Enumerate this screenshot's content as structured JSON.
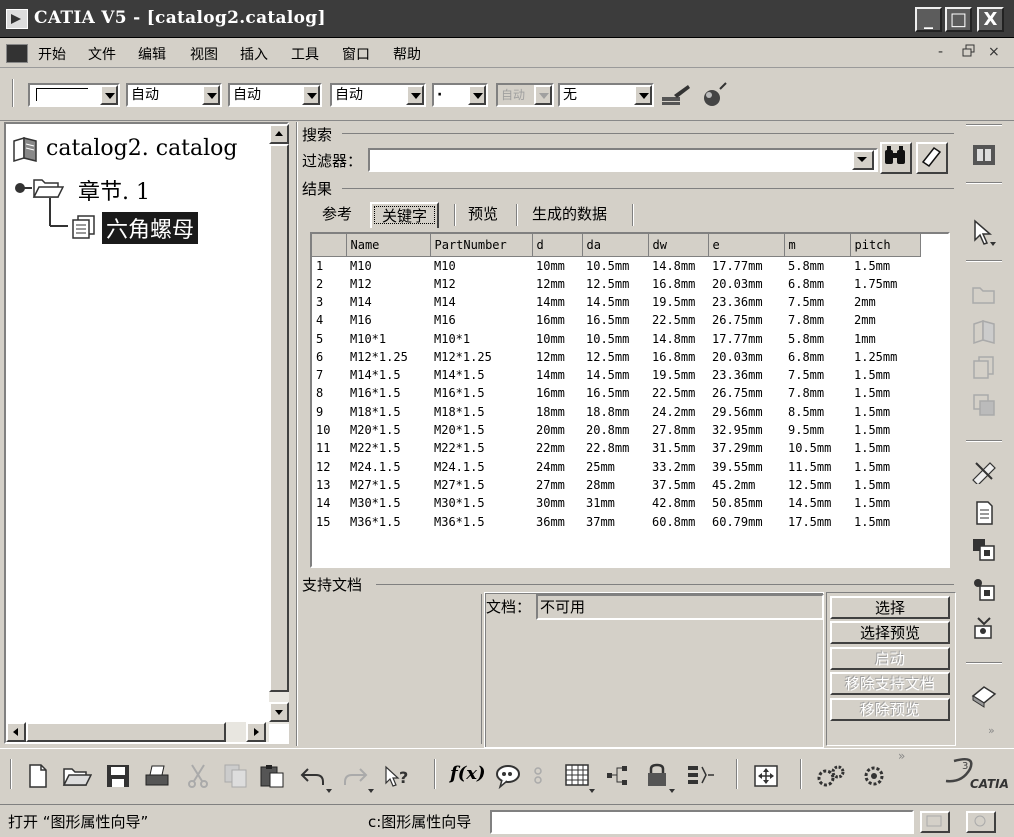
{
  "window": {
    "title": "CATIA V5 - [catalog2.catalog]",
    "caption_buttons": {
      "minimize": "_",
      "maximize": "□",
      "close": "X"
    }
  },
  "menu": {
    "items": [
      "开始",
      "文件",
      "编辑",
      "视图",
      "插入",
      "工具",
      "窗口",
      "帮助"
    ],
    "mdi": {
      "minimize": "-",
      "restore": "ꟷ",
      "close": "×"
    }
  },
  "toolbar": {
    "combos": [
      {
        "value": "",
        "disabled": false
      },
      {
        "value": "自动",
        "disabled": false
      },
      {
        "value": "自动",
        "disabled": false
      },
      {
        "value": "自动",
        "disabled": false
      },
      {
        "value": "·",
        "disabled": false
      },
      {
        "value": "自动",
        "disabled": true
      },
      {
        "value": "无",
        "disabled": false
      }
    ]
  },
  "tree": {
    "root": "catalog2. catalog",
    "chapter": "章节. 1",
    "family": "六角螺母"
  },
  "search": {
    "group_label": "搜索",
    "filter_label": "过滤器：",
    "filter_value": ""
  },
  "results": {
    "group_label": "结果",
    "tabs": [
      "参考",
      "关键字",
      "预览",
      "生成的数据"
    ],
    "active_tab": 1,
    "columns": [
      "",
      "Name",
      "PartNumber",
      "d",
      "da",
      "dw",
      "e",
      "m",
      "pitch"
    ],
    "rows": [
      [
        "1",
        "M10",
        "M10",
        "10mm",
        "10.5mm",
        "14.8mm",
        "17.77mm",
        "5.8mm",
        "1.5mm"
      ],
      [
        "2",
        "M12",
        "M12",
        "12mm",
        "12.5mm",
        "16.8mm",
        "20.03mm",
        "6.8mm",
        "1.75mm"
      ],
      [
        "3",
        "M14",
        "M14",
        "14mm",
        "14.5mm",
        "19.5mm",
        "23.36mm",
        "7.5mm",
        "2mm"
      ],
      [
        "4",
        "M16",
        "M16",
        "16mm",
        "16.5mm",
        "22.5mm",
        "26.75mm",
        "7.8mm",
        "2mm"
      ],
      [
        "5",
        "M10*1",
        "M10*1",
        "10mm",
        "10.5mm",
        "14.8mm",
        "17.77mm",
        "5.8mm",
        "1mm"
      ],
      [
        "6",
        "M12*1.25",
        "M12*1.25",
        "12mm",
        "12.5mm",
        "16.8mm",
        "20.03mm",
        "6.8mm",
        "1.25mm"
      ],
      [
        "7",
        "M14*1.5",
        "M14*1.5",
        "14mm",
        "14.5mm",
        "19.5mm",
        "23.36mm",
        "7.5mm",
        "1.5mm"
      ],
      [
        "8",
        "M16*1.5",
        "M16*1.5",
        "16mm",
        "16.5mm",
        "22.5mm",
        "26.75mm",
        "7.8mm",
        "1.5mm"
      ],
      [
        "9",
        "M18*1.5",
        "M18*1.5",
        "18mm",
        "18.8mm",
        "24.2mm",
        "29.56mm",
        "8.5mm",
        "1.5mm"
      ],
      [
        "10",
        "M20*1.5",
        "M20*1.5",
        "20mm",
        "20.8mm",
        "27.8mm",
        "32.95mm",
        "9.5mm",
        "1.5mm"
      ],
      [
        "11",
        "M22*1.5",
        "M22*1.5",
        "22mm",
        "22.8mm",
        "31.5mm",
        "37.29mm",
        "10.5mm",
        "1.5mm"
      ],
      [
        "12",
        "M24.1.5",
        "M24.1.5",
        "24mm",
        "25mm",
        "33.2mm",
        "39.55mm",
        "11.5mm",
        "1.5mm"
      ],
      [
        "13",
        "M27*1.5",
        "M27*1.5",
        "27mm",
        "28mm",
        "37.5mm",
        "45.2mm",
        "12.5mm",
        "1.5mm"
      ],
      [
        "14",
        "M30*1.5",
        "M30*1.5",
        "30mm",
        "31mm",
        "42.8mm",
        "50.85mm",
        "14.5mm",
        "1.5mm"
      ],
      [
        "15",
        "M36*1.5",
        "M36*1.5",
        "36mm",
        "37mm",
        "60.8mm",
        "60.79mm",
        "17.5mm",
        "1.5mm"
      ]
    ]
  },
  "support": {
    "group_label": "支持文档",
    "doc_label": "文档：",
    "doc_value": "不可用",
    "buttons": [
      {
        "label": "选择",
        "enabled": true
      },
      {
        "label": "选择预览",
        "enabled": true
      },
      {
        "label": "启动",
        "enabled": false
      },
      {
        "label": "移除支持文档",
        "enabled": false
      },
      {
        "label": "移除预览",
        "enabled": false
      }
    ]
  },
  "bottom_toolbar": {
    "fx_label": "f(x)",
    "brand": "CATIA",
    "icons": [
      "new-icon",
      "open-icon",
      "save-icon",
      "print-icon",
      "cut-icon",
      "copy-icon",
      "paste-icon",
      "undo-icon",
      "redo-icon",
      "whats-this-icon",
      "formula-icon",
      "comment-icon",
      "table-icon",
      "tree-icon",
      "lock-icon",
      "sketch-icon",
      "fit-all-icon",
      "settings-icon",
      "gear-icon"
    ]
  },
  "statusbar": {
    "message": "打开 “图形属性向导”",
    "prompt": "c:图形属性向导",
    "command_value": ""
  }
}
